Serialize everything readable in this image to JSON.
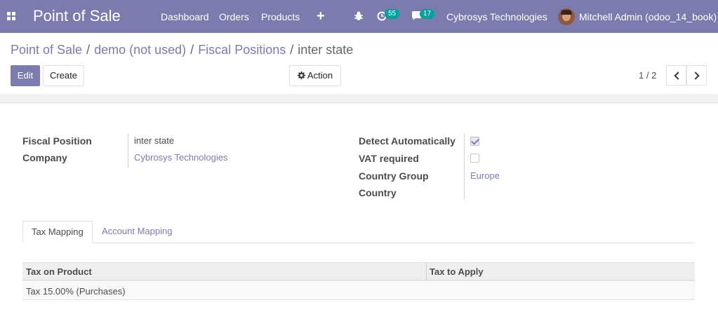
{
  "navbar": {
    "brand": "Point of Sale",
    "menu": [
      "Dashboard",
      "Orders",
      "Products"
    ],
    "plus_label": "+",
    "activity_count": "55",
    "messages_count": "17",
    "company": "Cybrosys Technologies",
    "user": "Mitchell Admin (odoo_14_book)",
    "icons": [
      "apps-icon",
      "plus-icon",
      "bug-icon",
      "activity-clock-icon",
      "chat-icon",
      "avatar"
    ]
  },
  "breadcrumb": {
    "items": [
      "Point of Sale",
      "demo (not used)",
      "Fiscal Positions"
    ],
    "current": "inter state",
    "separator": "/"
  },
  "controls": {
    "edit_label": "Edit",
    "create_label": "Create",
    "action_label": "Action",
    "pager": "1 / 2"
  },
  "form": {
    "left": [
      {
        "label": "Fiscal Position",
        "value": "inter state"
      },
      {
        "label": "Company",
        "value": "Cybrosys Technologies"
      }
    ],
    "right": {
      "detect_label": "Detect Automatically",
      "detect_checked": true,
      "vat_label": "VAT required",
      "vat_checked": false,
      "country_group_label": "Country Group",
      "country_group_value": "Europe",
      "country_label": "Country",
      "country_value": ""
    }
  },
  "tabs": [
    {
      "label": "Tax Mapping",
      "active": true
    },
    {
      "label": "Account Mapping",
      "active": false
    }
  ],
  "table": {
    "headers": [
      "Tax on Product",
      "Tax to Apply"
    ],
    "rows": [
      [
        "Tax 15.00% (Purchases)",
        ""
      ]
    ]
  },
  "colors": {
    "brand": "#7c7bad",
    "badge": "#00a09d"
  }
}
